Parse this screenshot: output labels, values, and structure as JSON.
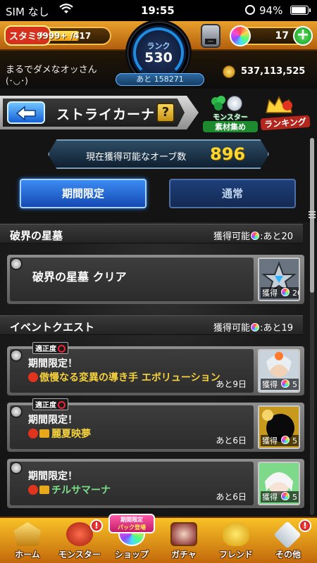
{
  "status_bar": {
    "carrier": "SIM なし",
    "time": "19:55",
    "battery_percent": "94%",
    "battery_level": 0.94
  },
  "header": {
    "stamina_label": "スタミナ",
    "stamina_value": "9999+ /417",
    "rank_label": "ランク",
    "rank_value": "530",
    "ticket_value": "---",
    "orb_count": "17",
    "username": "まるでダメなオッさん",
    "user_face": "(･◡･)",
    "exp_remaining": "あと 158271",
    "coins": "537,113,525"
  },
  "navi": {
    "title": "ストライカーナビ",
    "help_label": "?",
    "monster_material_label1": "モンスター",
    "monster_material_label2": "素材集め",
    "ranking_label": "ランキング"
  },
  "orb_panel": {
    "label": "現在獲得可能なオーブ数",
    "value": "896"
  },
  "tabs": [
    {
      "label": "期間限定",
      "active": true
    },
    {
      "label": "通常",
      "active": false
    }
  ],
  "sections": [
    {
      "title": "破界の星墓",
      "avail_prefix": "獲得可能",
      "avail_suffix": ":あと20",
      "cards": [
        {
          "title": "破界の星墓 クリア",
          "reward_label": "獲得",
          "reward_value": "20"
        }
      ]
    },
    {
      "title": "イベントクエスト",
      "avail_prefix": "獲得可能",
      "avail_suffix": ":あと19",
      "cards": [
        {
          "fit_label": "適正度",
          "limited_label": "期間限定！",
          "name": "傲慢なる変異の導き手 エボリューション",
          "remain": "あと9日",
          "reward_label": "獲得",
          "reward_value": "5"
        },
        {
          "fit_label": "適正度",
          "limited_label": "期間限定！",
          "name": "麗夏映夢",
          "remain": "あと6日",
          "reward_label": "獲得",
          "reward_value": "5"
        },
        {
          "limited_label": "期間限定！",
          "name": "チルサマーナ",
          "remain": "あと6日",
          "reward_label": "獲得",
          "reward_value": "5"
        }
      ]
    }
  ],
  "bottom_nav": {
    "home": "ホーム",
    "monster": "モンスター",
    "shop": "ショップ",
    "shop_badge_line1": "期間限定",
    "shop_badge_line2": "パック登場",
    "gacha": "ガチャ",
    "friend": "フレンド",
    "other": "その他",
    "alert_mark": "!"
  },
  "colors": {
    "accent_orange": "#e9a12b",
    "tab_active": "#3b8cf3",
    "orb_value": "#ffd62e",
    "quest_name": "#f6d23c"
  }
}
